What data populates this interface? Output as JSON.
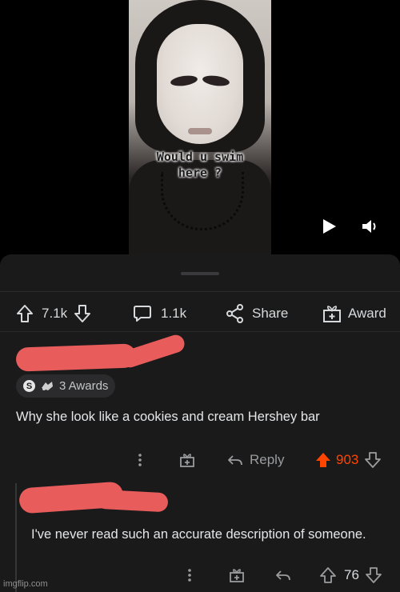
{
  "video": {
    "caption_line1": "Would u swim",
    "caption_line2": "here ?"
  },
  "actions": {
    "upvotes": "7.1k",
    "comments": "1.1k",
    "share_label": "Share",
    "award_label": "Award"
  },
  "comment1": {
    "awards_label": "3 Awards",
    "text": "Why she look like a cookies and cream Hershey bar",
    "reply_label": "Reply",
    "score": "903"
  },
  "comment2": {
    "text": "I've never read such an accurate description of someone.",
    "score": "76"
  },
  "watermark": "imgflip.com",
  "colors": {
    "upvote_active": "#ff4500",
    "redaction": "#e85c5c",
    "panel_bg": "#1a1a1b"
  }
}
